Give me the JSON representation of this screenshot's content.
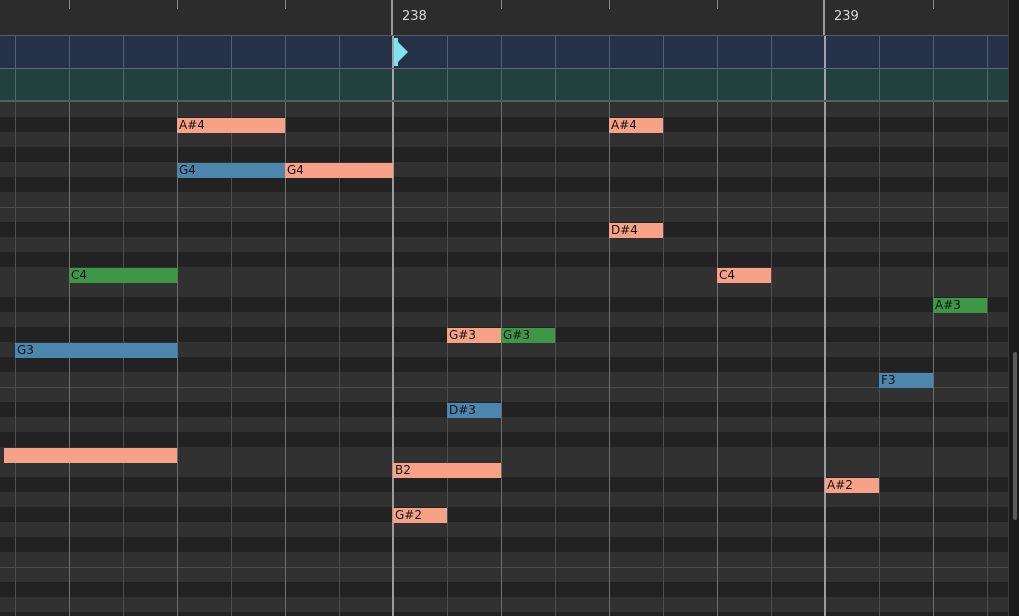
{
  "ruler": {
    "bars": [
      {
        "label": "238"
      },
      {
        "label": "239"
      }
    ]
  },
  "colors": {
    "salmon": "#f7a287",
    "blue": "#4c86ad",
    "green": "#3e9747",
    "playhead": "#7fe3ee"
  },
  "notes": [
    {
      "label": "A#4",
      "color": "salmon",
      "row": 1,
      "start": 177,
      "end": 285
    },
    {
      "label": "G4",
      "color": "blue",
      "row": 4,
      "start": 177,
      "end": 285
    },
    {
      "label": "G4",
      "color": "salmon",
      "row": 4,
      "start": 285,
      "end": 393
    },
    {
      "label": "A#4",
      "color": "salmon",
      "row": 1,
      "start": 609,
      "end": 663
    },
    {
      "label": "D#4",
      "color": "salmon",
      "row": 8,
      "start": 609,
      "end": 663
    },
    {
      "label": "C4",
      "color": "green",
      "row": 11,
      "start": 69,
      "end": 177
    },
    {
      "label": "C4",
      "color": "salmon",
      "row": 11,
      "start": 717,
      "end": 771
    },
    {
      "label": "A#3",
      "color": "green",
      "row": 13,
      "start": 933,
      "end": 987
    },
    {
      "label": "G#3",
      "color": "salmon",
      "row": 15,
      "start": 447,
      "end": 501
    },
    {
      "label": "G#3",
      "color": "green",
      "row": 15,
      "start": 501,
      "end": 555
    },
    {
      "label": "G3",
      "color": "blue",
      "row": 16,
      "start": 15,
      "end": 177
    },
    {
      "label": "F3",
      "color": "blue",
      "row": 18,
      "start": 879,
      "end": 933
    },
    {
      "label": "D#3",
      "color": "blue",
      "row": 20,
      "start": 447,
      "end": 501
    },
    {
      "label": "",
      "color": "salmon",
      "row": 23,
      "start": 4,
      "end": 177
    },
    {
      "label": "B2",
      "color": "salmon",
      "row": 24,
      "start": 393,
      "end": 501
    },
    {
      "label": "A#2",
      "color": "salmon",
      "row": 25,
      "start": 825,
      "end": 879
    },
    {
      "label": "G#2",
      "color": "salmon",
      "row": 27,
      "start": 393,
      "end": 447
    }
  ]
}
